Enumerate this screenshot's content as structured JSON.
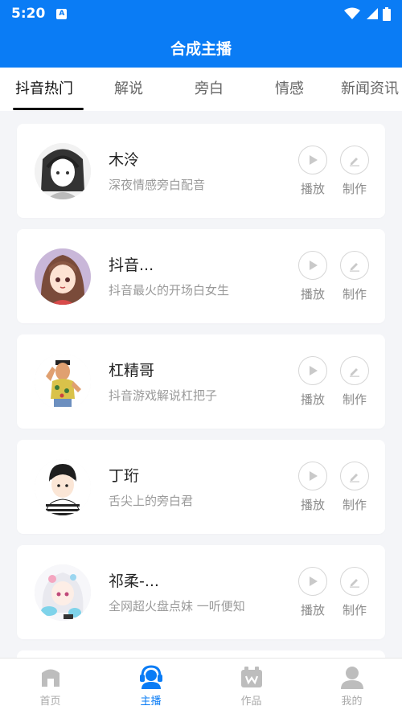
{
  "status": {
    "time": "5:20",
    "badge": "A"
  },
  "header": {
    "title": "合成主播"
  },
  "tabs": [
    {
      "label": "抖音热门",
      "active": true
    },
    {
      "label": "解说",
      "active": false
    },
    {
      "label": "旁白",
      "active": false
    },
    {
      "label": "情感",
      "active": false
    },
    {
      "label": "新闻资讯",
      "active": false
    }
  ],
  "cards": [
    {
      "name": "木泠",
      "desc": "深夜情感旁白配音",
      "play": "播放",
      "make": "制作"
    },
    {
      "name": "抖音...",
      "desc": "抖音最火的开场白女生",
      "play": "播放",
      "make": "制作"
    },
    {
      "name": "杠精哥",
      "desc": "抖音游戏解说杠把子",
      "play": "播放",
      "make": "制作"
    },
    {
      "name": "丁珩",
      "desc": "舌尖上的旁白君",
      "play": "播放",
      "make": "制作"
    },
    {
      "name": "祁柔-...",
      "desc": "全网超火盘点妹 一听便知",
      "play": "播放",
      "make": "制作"
    }
  ],
  "nav": [
    {
      "label": "首页",
      "icon": "home-icon",
      "active": false
    },
    {
      "label": "主播",
      "icon": "anchor-icon",
      "active": true
    },
    {
      "label": "作品",
      "icon": "works-icon",
      "active": false
    },
    {
      "label": "我的",
      "icon": "profile-icon",
      "active": false
    }
  ],
  "colors": {
    "primary": "#0a7cf5"
  }
}
